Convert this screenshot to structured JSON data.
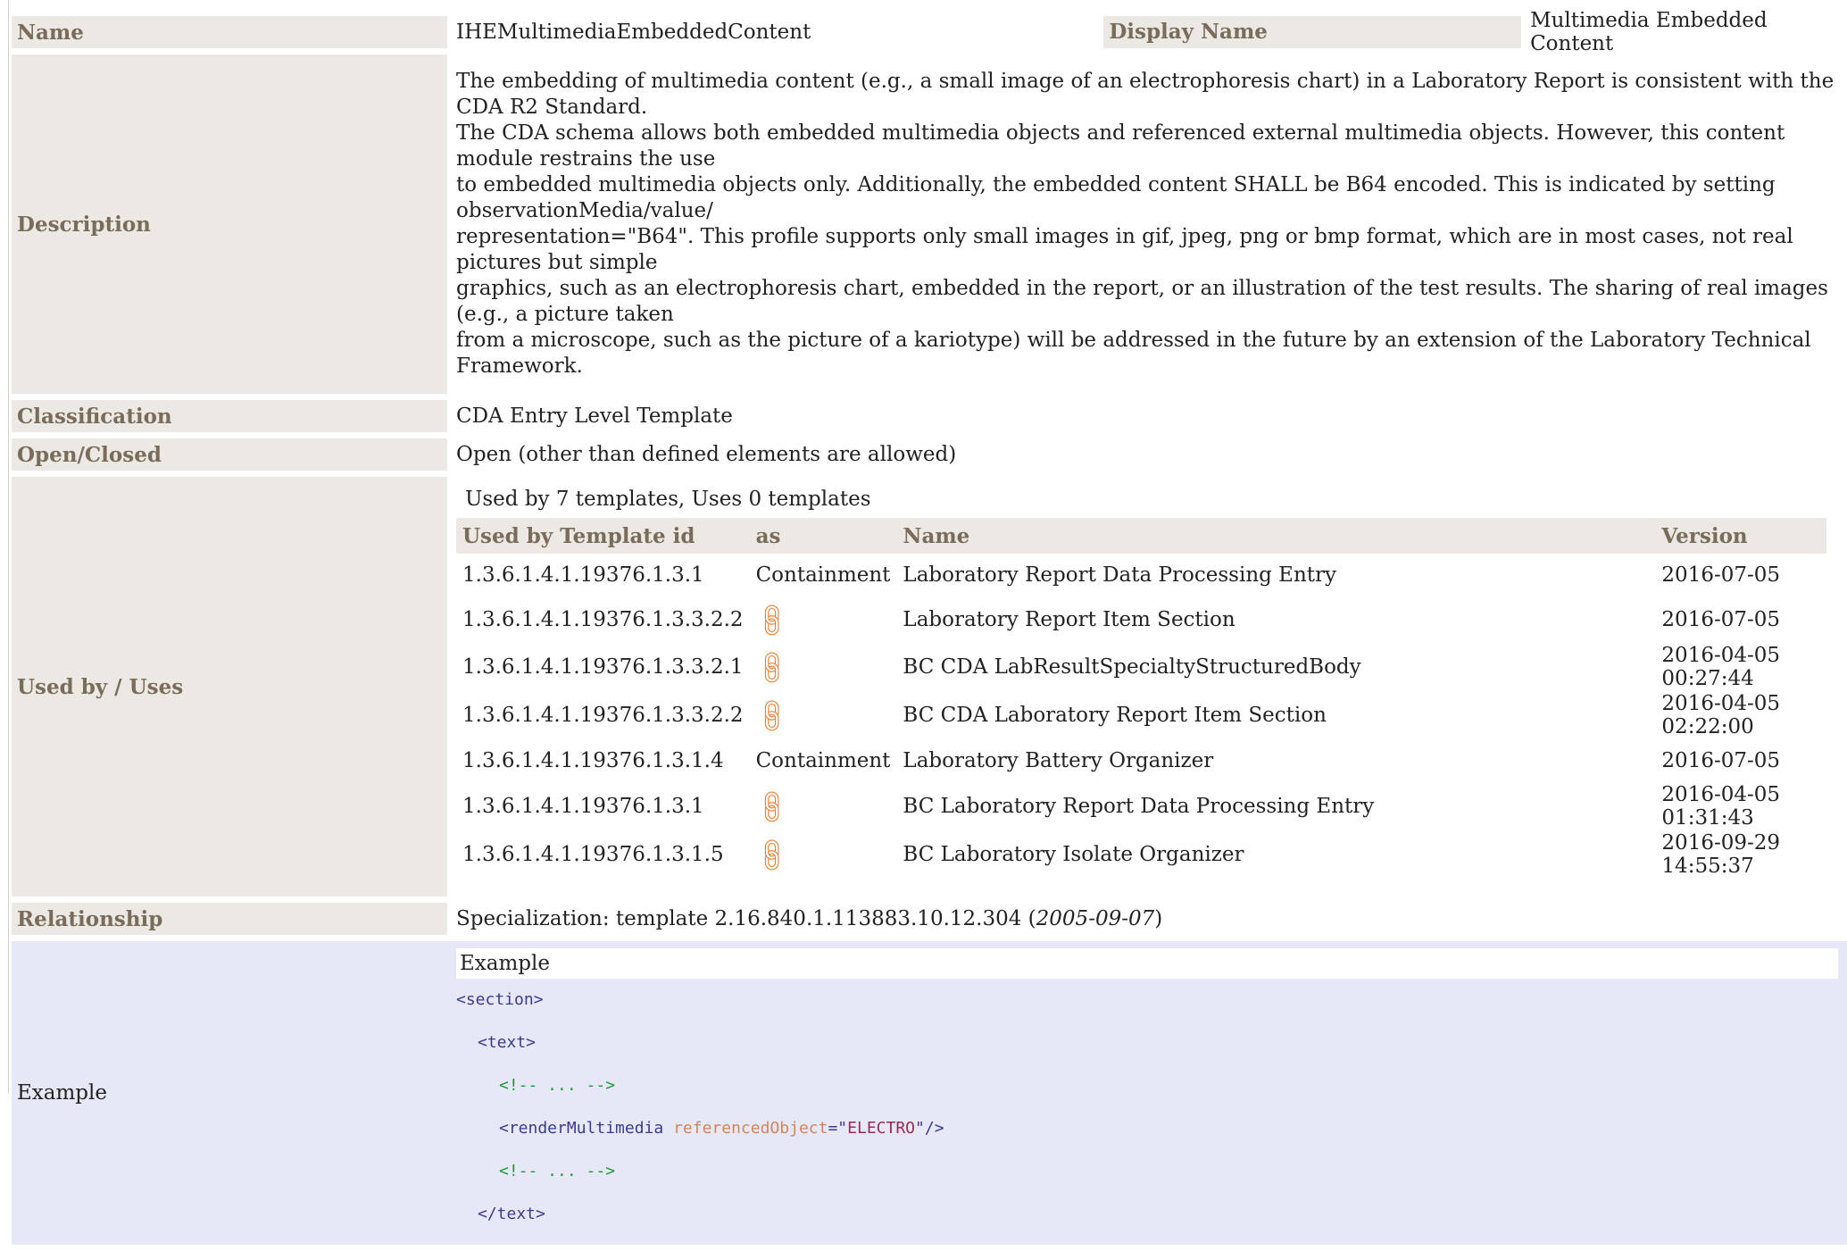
{
  "name_label": "Name",
  "name_value": "IHEMultimediaEmbeddedContent",
  "display_name_label": "Display Name",
  "display_name_value": "Multimedia Embedded Content",
  "description_label": "Description",
  "description_lines": [
    "The embedding of multimedia content (e.g., a small image of an electrophoresis chart) in a Laboratory Report is consistent with the CDA R2 Standard.",
    "The CDA schema allows both embedded multimedia objects and referenced external multimedia objects. However, this content module restrains the use",
    "to embedded multimedia objects only. Additionally, the embedded content SHALL be B64 encoded. This is indicated by setting observationMedia/value/",
    "representation=\"B64\". This profile supports only small images in gif, jpeg, png or bmp format, which are in most cases, not real pictures but simple",
    "graphics, such as an electrophoresis chart, embedded in the report, or an illustration of the test results. The sharing of real images (e.g., a picture taken",
    "from a microscope, such as the picture of a kariotype) will be addressed in the future by an extension of the Laboratory Technical Framework."
  ],
  "classification_label": "Classification",
  "classification_value": "CDA Entry Level Template",
  "openclosed_label": "Open/Closed",
  "openclosed_value": "Open (other than defined elements are allowed)",
  "usedby_label": "Used by / Uses",
  "usedby_summary": "Used by 7 templates, Uses 0 templates",
  "usedby_columns": [
    "Used by Template id",
    "as",
    "Name",
    "Version"
  ],
  "usedby_rows": [
    {
      "id": "1.3.6.1.4.1.19376.1.3.1",
      "as": "Containment",
      "name": "Laboratory Report Data Processing Entry",
      "version": "2016-07-05"
    },
    {
      "id": "1.3.6.1.4.1.19376.1.3.3.2.2",
      "as": "",
      "name": "Laboratory Report Item Section",
      "version": "2016-07-05"
    },
    {
      "id": "1.3.6.1.4.1.19376.1.3.3.2.1",
      "as": "",
      "name": "BC CDA LabResultSpecialtyStructuredBody",
      "version": "2016-04-05 00:27:44"
    },
    {
      "id": "1.3.6.1.4.1.19376.1.3.3.2.2",
      "as": "",
      "name": "BC CDA Laboratory Report Item Section",
      "version": "2016-04-05 02:22:00"
    },
    {
      "id": "1.3.6.1.4.1.19376.1.3.1.4",
      "as": "Containment",
      "name": "Laboratory Battery Organizer",
      "version": "2016-07-05"
    },
    {
      "id": "1.3.6.1.4.1.19376.1.3.1",
      "as": "",
      "name": "BC Laboratory Report Data Processing Entry",
      "version": "2016-04-05 01:31:43"
    },
    {
      "id": "1.3.6.1.4.1.19376.1.3.1.5",
      "as": "",
      "name": "BC Laboratory Isolate Organizer",
      "version": "2016-09-29 14:55:37"
    }
  ],
  "link_icon": "link-icon",
  "relationship_label": "Relationship",
  "relationship_prefix": "Specialization: template 2.16.840.1.113883.10.12.304 (",
  "relationship_date": "2005-09-07",
  "relationship_suffix": ")",
  "example_label": "Example",
  "example_header": "Example",
  "code": {
    "l1": "<section>",
    "l2": "<text>",
    "l3": "<!-- ... -->",
    "l4_tag": "<renderMultimedia",
    "l4_attr": "referencedObject",
    "l4_eq": "=\"",
    "l4_val": "ELECTRO",
    "l4_end": "\"/>",
    "l5": "<!-- ... -->",
    "l6": "</text>"
  },
  "colors": {
    "label_bg": "#ece9e4",
    "label_text": "#7a6c5b",
    "example_bg": "#e6e8f7",
    "link_icon": "#ec7c2c"
  }
}
